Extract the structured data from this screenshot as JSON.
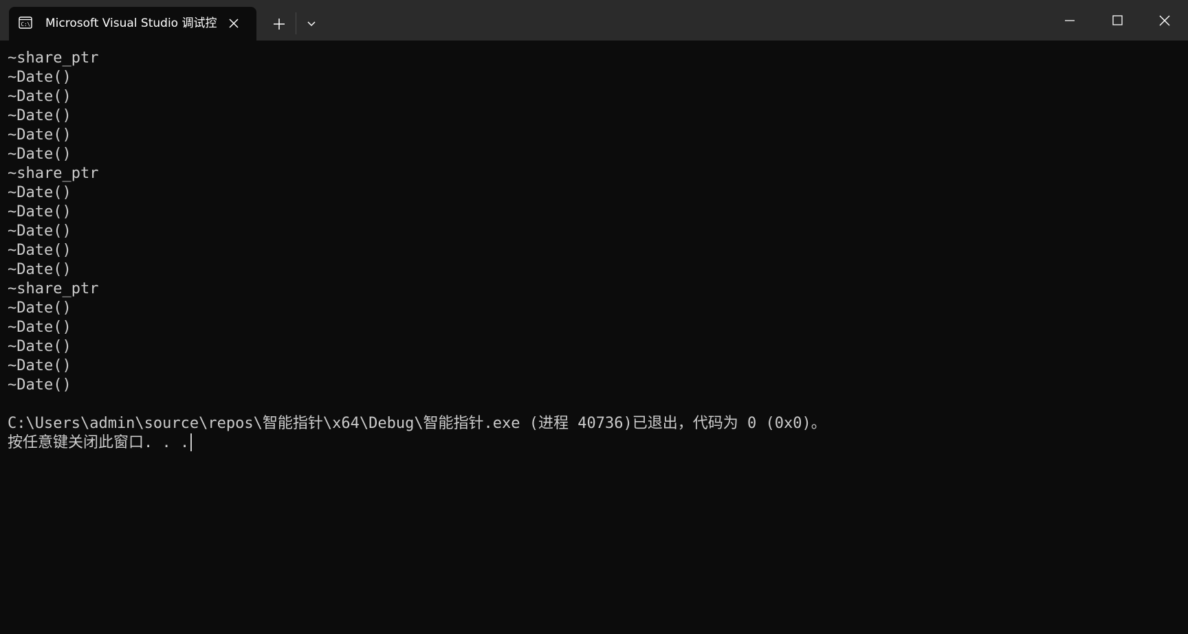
{
  "window": {
    "tab_title": "Microsoft Visual Studio 调试控",
    "icons": {
      "tab": "console-icon",
      "tab_close": "close-icon",
      "new_tab": "plus-icon",
      "dropdown": "chevron-down-icon",
      "minimize": "minimize-icon",
      "maximize": "maximize-icon",
      "close": "close-icon"
    },
    "colors": {
      "titlebar_bg": "#2b2b2b",
      "terminal_bg": "#0c0c0c",
      "text": "#cccccc"
    }
  },
  "terminal": {
    "lines": [
      "~share_ptr",
      "~Date()",
      "~Date()",
      "~Date()",
      "~Date()",
      "~Date()",
      "~share_ptr",
      "~Date()",
      "~Date()",
      "~Date()",
      "~Date()",
      "~Date()",
      "~share_ptr",
      "~Date()",
      "~Date()",
      "~Date()",
      "~Date()",
      "~Date()",
      "",
      "C:\\Users\\admin\\source\\repos\\智能指针\\x64\\Debug\\智能指针.exe (进程 40736)已退出，代码为 0 (0x0)。",
      "按任意键关闭此窗口. . ."
    ]
  }
}
